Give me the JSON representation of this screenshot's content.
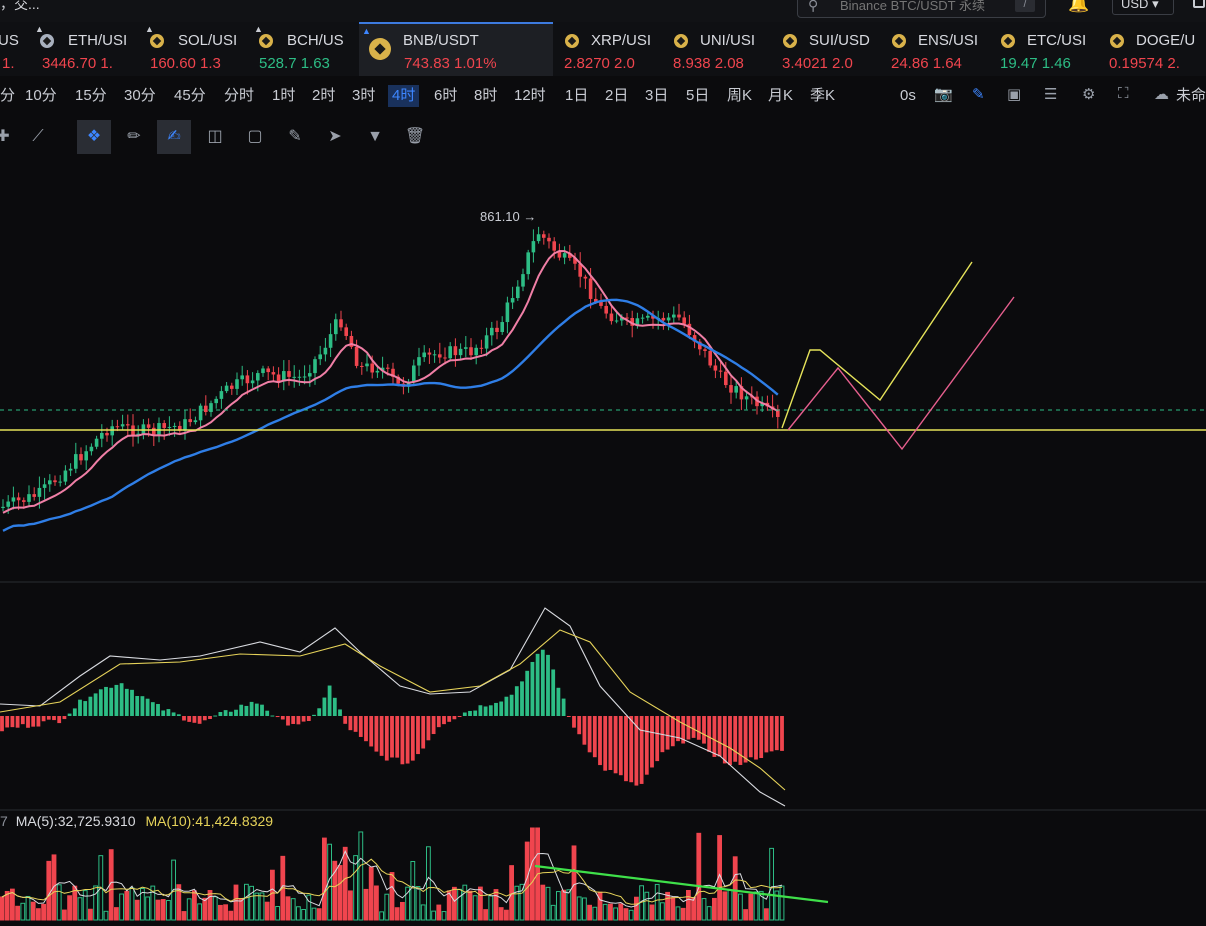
{
  "topbar": {
    "brand_fragment": "，交...",
    "search_placeholder": "Binance BTC/USDT 永续",
    "search_shortcut": "/",
    "currency": "USD"
  },
  "tickers": [
    {
      "symbol": "USI",
      "price": "1.",
      "dir": "down"
    },
    {
      "symbol": "ETH/USI",
      "price": "3446.70  1.",
      "dir": "down"
    },
    {
      "symbol": "SOL/USI",
      "price": "160.60  1.3",
      "dir": "down"
    },
    {
      "symbol": "BCH/US",
      "price": "528.7  1.63",
      "dir": "up"
    },
    {
      "symbol": "BNB/USDT",
      "price": "743.83  1.01%",
      "dir": "down",
      "active": true
    },
    {
      "symbol": "XRP/USI",
      "price": "2.8270  2.0",
      "dir": "down"
    },
    {
      "symbol": "UNI/USI",
      "price": "8.938  2.08",
      "dir": "down"
    },
    {
      "symbol": "SUI/USD",
      "price": "3.4021  2.0",
      "dir": "down"
    },
    {
      "symbol": "ENS/USI",
      "price": "24.86  1.64",
      "dir": "down"
    },
    {
      "symbol": "ETC/USI",
      "price": "19.47  1.46",
      "dir": "up"
    },
    {
      "symbol": "DOGE/U",
      "price": "0.19574  2.",
      "dir": "down"
    }
  ],
  "intervals": [
    "分",
    "10分",
    "15分",
    "30分",
    "45分",
    "分时",
    "1时",
    "2时",
    "3时",
    "4时",
    "6时",
    "8时",
    "12时",
    "1日",
    "2日",
    "3日",
    "5日",
    "周K",
    "月K",
    "季K"
  ],
  "selected_interval": "4时",
  "interval_right": {
    "countdown": "0s",
    "cloud_label": "未命"
  },
  "chart": {
    "high_label": "861.10",
    "volume_legend": {
      "prefix": "7",
      "ma5": "MA(5):32,725.9310",
      "ma10": "MA(10):41,424.8329"
    }
  },
  "colors": {
    "up": "#2dbd85",
    "down": "#f0454e",
    "accent": "#3d86ff",
    "ma_short": "#f07fa6",
    "ma_long": "#2f7ee6",
    "annotation_yellow": "#e6e35a",
    "annotation_pink": "#e65f8e",
    "trend_green": "#3fe04a"
  }
}
